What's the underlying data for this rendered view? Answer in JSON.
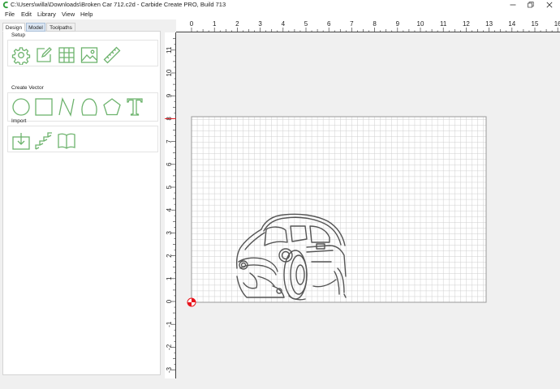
{
  "window": {
    "title": "C:\\Users\\willa\\Downloads\\Broken Car 712.c2d - Carbide Create PRO, Build 713",
    "icons": [
      "carbide-create-icon",
      "minimize-icon",
      "restore-icon",
      "close-icon"
    ]
  },
  "menu": {
    "items": [
      "File",
      "Edit",
      "Library",
      "View",
      "Help"
    ]
  },
  "tabs": [
    {
      "label": "Design",
      "state": "active"
    },
    {
      "label": "Model",
      "state": "selected"
    },
    {
      "label": "Toolpaths",
      "state": "normal"
    }
  ],
  "groups": [
    {
      "title": "Setup",
      "tools": [
        "gear-icon",
        "edit-icon",
        "grid-icon",
        "image-icon",
        "ruler-icon"
      ]
    },
    {
      "title": "Create Vector",
      "tools": [
        "circle-icon",
        "rectangle-icon",
        "polyline-icon",
        "curve-icon",
        "polygon-icon",
        "text-icon"
      ]
    },
    {
      "title": "Import",
      "tools": [
        "import-icon",
        "stairs-icon",
        "book-icon"
      ]
    }
  ],
  "ruler": {
    "x_labels": [
      "0",
      "1",
      "2",
      "3",
      "4",
      "5",
      "6",
      "7",
      "8",
      "9",
      "10",
      "11",
      "12",
      "13",
      "14",
      "15",
      "16"
    ],
    "y_labels": [
      "11",
      "10",
      "9",
      "8",
      "7",
      "6",
      "5",
      "4",
      "3",
      "2",
      "1",
      "0",
      "-1",
      "-2",
      "-3"
    ]
  },
  "stock": {
    "width": 13,
    "height": 8,
    "origin": "bottom-left"
  },
  "theme": {
    "accent": "#6db36d",
    "grid": "#cfcfcf",
    "origin_marker": "#e8141c"
  }
}
